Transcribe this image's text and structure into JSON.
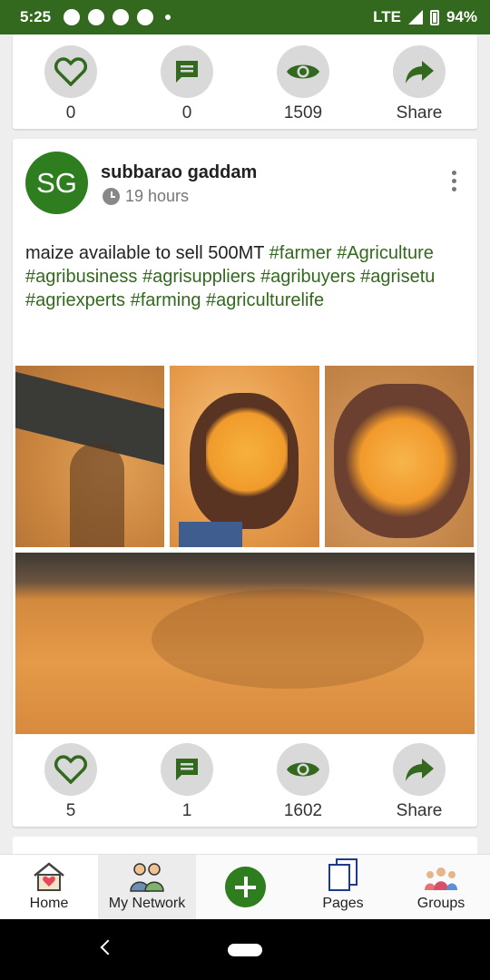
{
  "status_bar": {
    "time": "5:25",
    "network": "LTE",
    "battery": "94%"
  },
  "top_card": {
    "likes": "0",
    "comments": "0",
    "views": "1509",
    "share_label": "Share"
  },
  "post": {
    "avatar_initials": "SG",
    "author": "subbarao gaddam",
    "time": "19 hours",
    "text": "maize available to sell 500MT",
    "hashtags": [
      "#farmer",
      "#Agriculture",
      "#agribusiness",
      "#agrisuppliers",
      "#agribuyers",
      "#agrisetu",
      "#agriexperts",
      "#farming",
      "#agriculturelife"
    ],
    "likes": "5",
    "comments": "1",
    "views": "1602",
    "share_label": "Share"
  },
  "bottom_nav": {
    "home": "Home",
    "network": "My Network",
    "pages": "Pages",
    "groups": "Groups"
  },
  "colors": {
    "brand_green": "#33691e",
    "avatar_green": "#2e7d1f",
    "icon_bg": "#d9d9d9"
  }
}
